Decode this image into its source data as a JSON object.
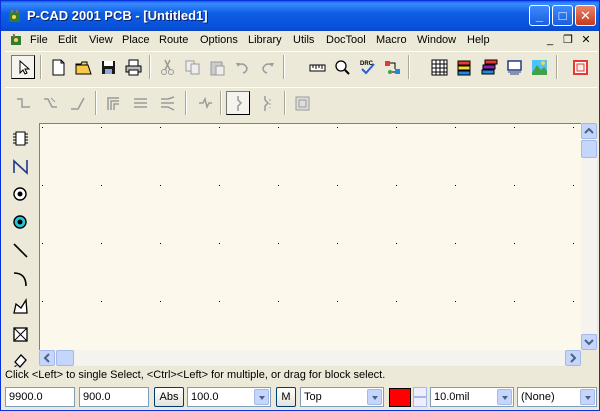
{
  "window": {
    "title": "P-CAD 2001 PCB - [Untitled1]",
    "controls": {
      "minimize": "_",
      "maximize": "□",
      "close": "✕"
    }
  },
  "menu": {
    "items": [
      "File",
      "Edit",
      "View",
      "Place",
      "Route",
      "Options",
      "Library",
      "Utils",
      "DocTool",
      "Macro",
      "Window",
      "Help"
    ],
    "mdi_controls": {
      "minimize": "_",
      "restore": "❐",
      "close": "✕"
    }
  },
  "toolbar_main": {
    "buttons": [
      "select-arrow-icon",
      "new-file-icon",
      "open-folder-icon",
      "save-disk-icon",
      "print-icon",
      "cut-icon",
      "copy-icon",
      "paste-icon",
      "undo-icon",
      "redo-icon",
      "measure-ruler-icon",
      "zoom-magnifier-icon",
      "drc-check-icon",
      "net-icon",
      "spreadsheet-icon",
      "layers-icon",
      "layer-sets-icon",
      "pads-icon",
      "terrain-icon",
      "3d-view-icon"
    ],
    "drc_label": "DRC"
  },
  "toolbar_route": {
    "buttons": [
      "route-manual-icon",
      "route-interactive-icon",
      "route-miter-icon",
      "route-bus-icon",
      "route-multi-icon",
      "route-fanout-icon",
      "route-push-icon",
      "route-sketch-icon",
      "route-gap-icon",
      "route-hug-icon"
    ]
  },
  "toolbar_place": {
    "buttons": [
      "place-component-icon",
      "place-connection-icon",
      "place-pad-icon",
      "place-via-icon",
      "place-line-icon",
      "place-arc-icon",
      "place-polygon-icon",
      "place-keepout-icon",
      "place-copper-pour-icon"
    ]
  },
  "status": {
    "hint": "Click <Left> to single Select, <Ctrl><Left> for multiple, or drag for block select.",
    "x_coord": "9900.0",
    "y_coord": "900.0",
    "abs_label": "Abs",
    "zoom": "100.0",
    "m_label": "M",
    "layer": "Top",
    "layer_color": "#ff0000",
    "line_width": "10.0mil",
    "net": "(None)"
  },
  "colors": {
    "canvas_bg": "#fcf8ec",
    "grid_dot": "#000000",
    "title_blue": "#0a5ff5"
  }
}
